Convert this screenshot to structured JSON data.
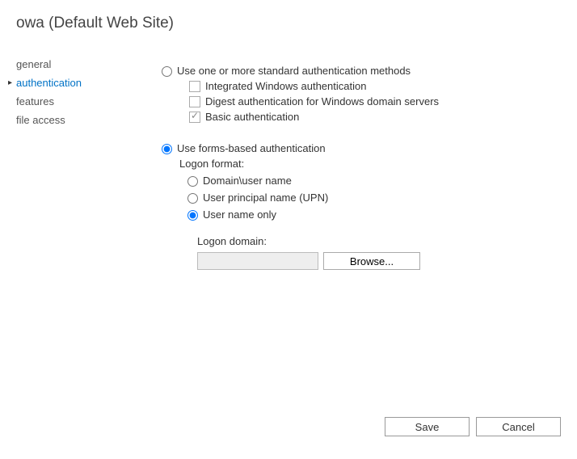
{
  "title": "owa (Default Web Site)",
  "sidebar": {
    "items": [
      {
        "label": "general",
        "active": false
      },
      {
        "label": "authentication",
        "active": true
      },
      {
        "label": "features",
        "active": false
      },
      {
        "label": "file access",
        "active": false
      }
    ]
  },
  "auth": {
    "standard": {
      "label": "Use one or more standard authentication methods",
      "integrated": "Integrated Windows authentication",
      "digest": "Digest authentication for Windows domain servers",
      "basic": "Basic authentication"
    },
    "forms": {
      "label": "Use forms-based authentication",
      "logonFormat": "Logon format:",
      "domainUser": "Domain\\user name",
      "upn": "User principal name (UPN)",
      "userOnly": "User name only",
      "logonDomainLabel": "Logon domain:",
      "logonDomainValue": "",
      "browse": "Browse..."
    }
  },
  "buttons": {
    "save": "Save",
    "cancel": "Cancel"
  }
}
